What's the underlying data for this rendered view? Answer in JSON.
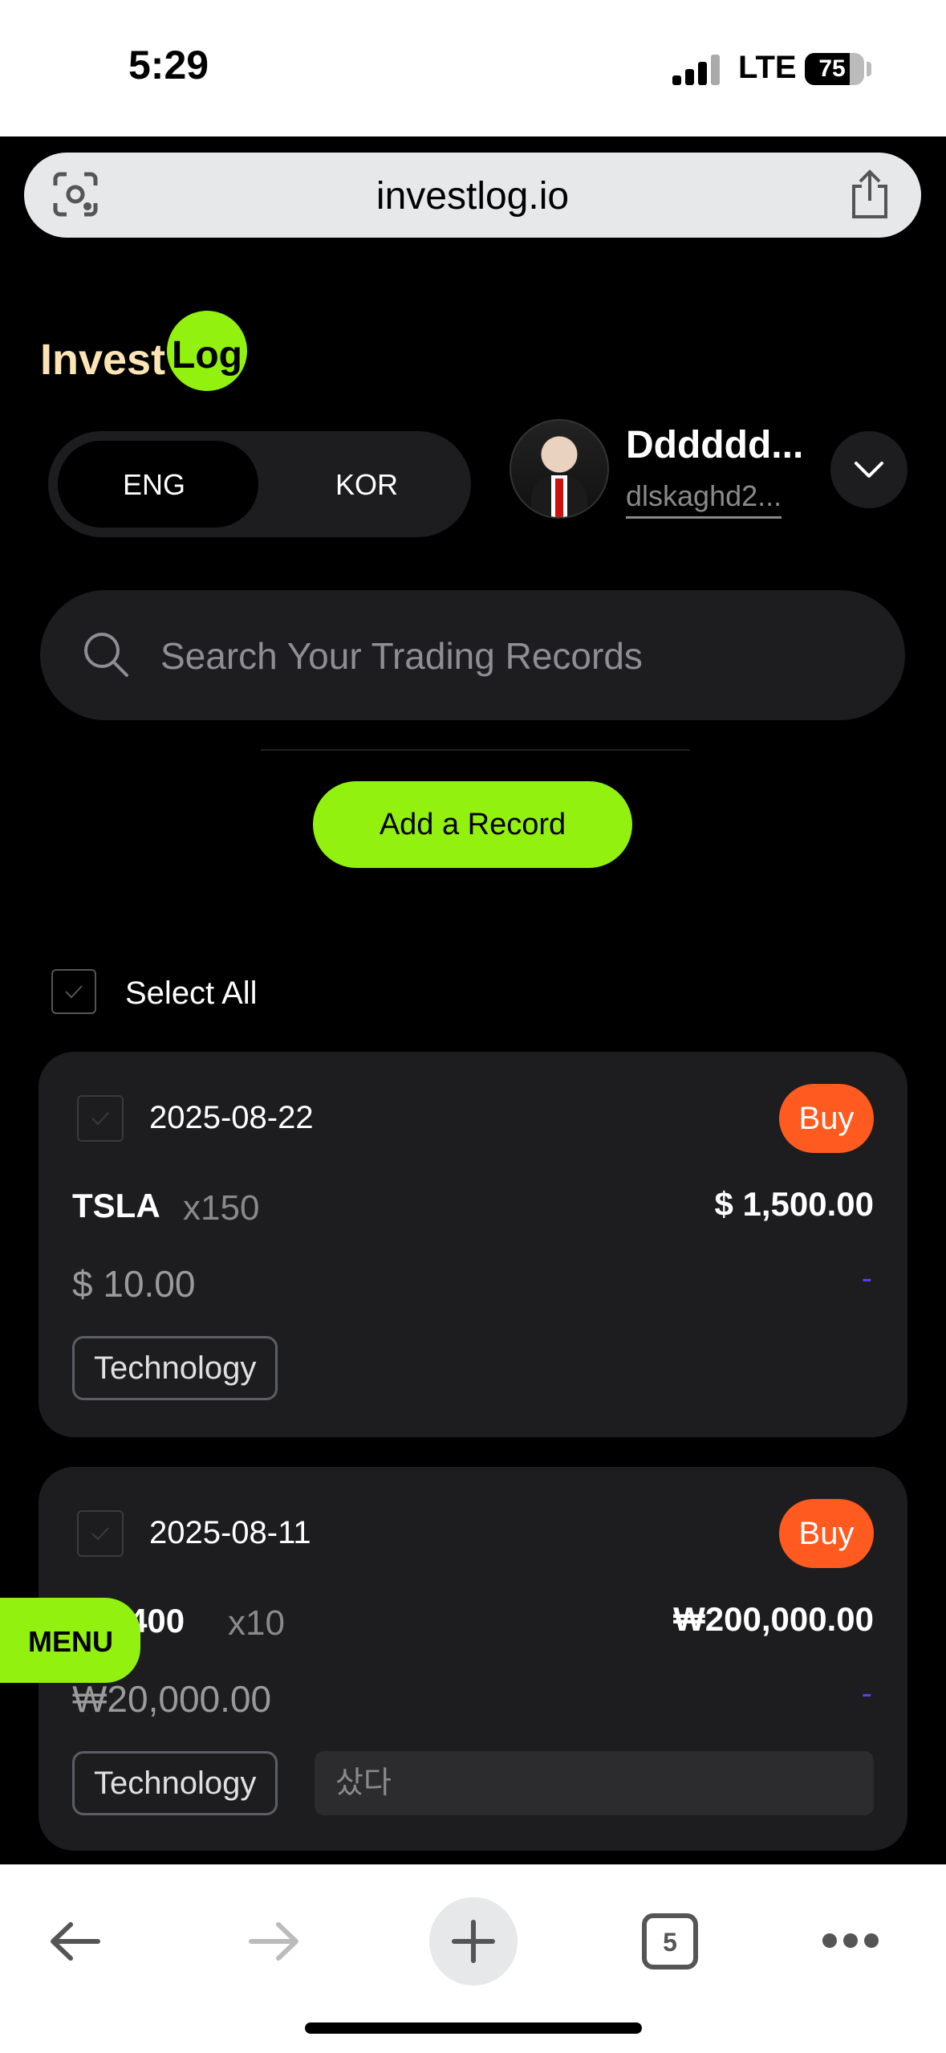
{
  "status": {
    "time": "5:29",
    "network": "LTE",
    "battery": "75",
    "battery_level": 0.75
  },
  "browser": {
    "url": "investlog.io",
    "tab_count": "5"
  },
  "brand": {
    "word": "Invest",
    "badge": "Log",
    "accent": "#93f10f"
  },
  "lang_toggle": {
    "options": [
      "ENG",
      "KOR"
    ],
    "selected": "ENG"
  },
  "user": {
    "name": "Dddddd...",
    "email": "dlskaghd2..."
  },
  "search": {
    "placeholder": "Search Your Trading Records"
  },
  "add_record_label": "Add a Record",
  "select_all_label": "Select All",
  "records": [
    {
      "date": "2025-08-22",
      "type": "Buy",
      "ticker": "TSLA",
      "qty": "x150",
      "total": "$ 1,500.00",
      "price": "$ 10.00",
      "change": "-",
      "tag": "Technology",
      "memo": ""
    },
    {
      "date": "2025-08-11",
      "type": "Buy",
      "ticker": "020400",
      "qty": "x10",
      "total": "₩200,000.00",
      "price": "₩20,000.00",
      "change": "-",
      "tag": "Technology",
      "memo": "샀다"
    }
  ],
  "menu_label": "MENU",
  "colors": {
    "buy_badge": "#ff5a1f",
    "change_dash": "#5b3cf0"
  }
}
